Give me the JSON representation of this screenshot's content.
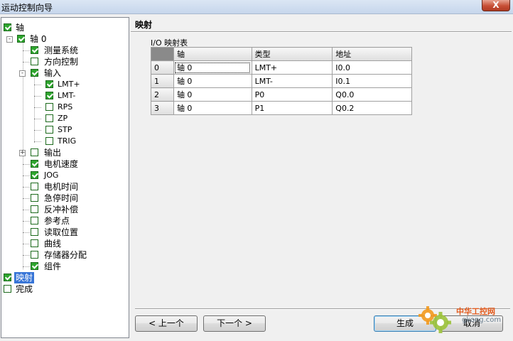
{
  "window": {
    "title": "运动控制向导",
    "close_label": "X"
  },
  "tree": {
    "items": [
      {
        "label": "轴",
        "state": "checked"
      },
      {
        "label": "轴 0",
        "state": "checked",
        "expander": "-"
      },
      {
        "label": "测量系统",
        "state": "checked"
      },
      {
        "label": "方向控制",
        "state": "unchecked"
      },
      {
        "label": "输入",
        "state": "checked",
        "expander": "-"
      },
      {
        "label": "LMT+",
        "state": "checked"
      },
      {
        "label": "LMT-",
        "state": "checked"
      },
      {
        "label": "RPS",
        "state": "unchecked"
      },
      {
        "label": "ZP",
        "state": "unchecked"
      },
      {
        "label": "STP",
        "state": "unchecked"
      },
      {
        "label": "TRIG",
        "state": "unchecked"
      },
      {
        "label": "输出",
        "state": "unchecked",
        "expander": "+"
      },
      {
        "label": "电机速度",
        "state": "checked"
      },
      {
        "label": "JOG",
        "state": "checked"
      },
      {
        "label": "电机时间",
        "state": "unchecked"
      },
      {
        "label": "急停时间",
        "state": "unchecked"
      },
      {
        "label": "反冲补偿",
        "state": "unchecked"
      },
      {
        "label": "参考点",
        "state": "unchecked"
      },
      {
        "label": "读取位置",
        "state": "unchecked"
      },
      {
        "label": "曲线",
        "state": "unchecked"
      },
      {
        "label": "存储器分配",
        "state": "unchecked"
      },
      {
        "label": "组件",
        "state": "checked"
      },
      {
        "label": "映射",
        "state": "checked",
        "selected": true
      },
      {
        "label": "完成",
        "state": "unchecked"
      }
    ]
  },
  "main": {
    "title": "映射",
    "table_caption": "I/O 映射表",
    "columns": [
      "轴",
      "类型",
      "地址"
    ],
    "rows": [
      {
        "index": "0",
        "axis": "轴 0",
        "type": "LMT+",
        "address": "I0.0"
      },
      {
        "index": "1",
        "axis": "轴 0",
        "type": "LMT-",
        "address": "I0.1"
      },
      {
        "index": "2",
        "axis": "轴 0",
        "type": "P0",
        "address": "Q0.0"
      },
      {
        "index": "3",
        "axis": "轴 0",
        "type": "P1",
        "address": "Q0.2"
      }
    ]
  },
  "buttons": {
    "prev": "< 上一个",
    "next": "下一个 >",
    "finish": "生成",
    "cancel": "取消"
  },
  "watermark": {
    "title": "中华工控网",
    "sub": "gkong.com"
  },
  "colors": {
    "check_green": "#2ea52e",
    "selection_blue": "#3875d7",
    "watermark_orange": "#e35a1c"
  }
}
